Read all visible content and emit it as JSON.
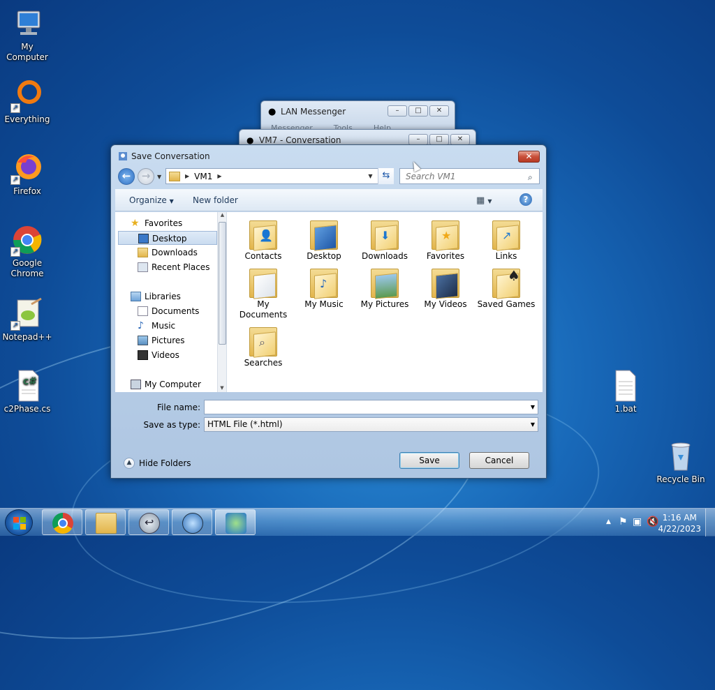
{
  "desktop": {
    "icons": [
      {
        "label": "My Computer",
        "icon": "computer-icon"
      },
      {
        "label": "Everything",
        "icon": "everything-icon"
      },
      {
        "label": "Firefox",
        "icon": "firefox-icon"
      },
      {
        "label": "Google Chrome",
        "icon": "chrome-icon"
      },
      {
        "label": "Notepad++",
        "icon": "notepadpp-icon"
      },
      {
        "label": "c2Phase.cs",
        "icon": "csharp-file-icon"
      },
      {
        "label": "1.bat",
        "icon": "bat-file-icon"
      },
      {
        "label": "Recycle Bin",
        "icon": "recycle-bin-icon"
      }
    ]
  },
  "bg_windows": {
    "lan_messenger": {
      "title": "LAN Messenger",
      "menu": [
        "Messenger",
        "Tools",
        "Help"
      ]
    },
    "conversation": {
      "title": "VM7 - Conversation"
    }
  },
  "dialog": {
    "title": "Save Conversation",
    "close_label": "✕",
    "address": {
      "crumb": "VM1"
    },
    "search_placeholder": "Search VM1",
    "toolbar": {
      "organize": "Organize",
      "new_folder": "New folder",
      "help": "?"
    },
    "nav": {
      "favorites": "Favorites",
      "desktop": "Desktop",
      "downloads": "Downloads",
      "recent_places": "Recent Places",
      "libraries": "Libraries",
      "documents": "Documents",
      "music": "Music",
      "pictures": "Pictures",
      "videos": "Videos",
      "my_computer": "My Computer"
    },
    "files": [
      {
        "label": "Contacts",
        "glyph": "contacts-icon"
      },
      {
        "label": "Desktop",
        "glyph": "desktop-icon"
      },
      {
        "label": "Downloads",
        "glyph": "download-icon"
      },
      {
        "label": "Favorites",
        "glyph": "star-icon"
      },
      {
        "label": "Links",
        "glyph": "link-icon"
      },
      {
        "label": "My Documents",
        "glyph": "document-icon"
      },
      {
        "label": "My Music",
        "glyph": "music-icon"
      },
      {
        "label": "My Pictures",
        "glyph": "picture-icon"
      },
      {
        "label": "My Videos",
        "glyph": "video-icon"
      },
      {
        "label": "Saved Games",
        "glyph": "games-icon"
      },
      {
        "label": "Searches",
        "glyph": "magnifier-icon"
      }
    ],
    "file_name_label": "File name:",
    "file_name_value": "",
    "save_type_label": "Save as type:",
    "save_type_value": "HTML File (*.html)",
    "save_button": "Save",
    "cancel_button": "Cancel",
    "hide_folders": "Hide Folders"
  },
  "taskbar": {
    "clock_time": "1:16 AM",
    "clock_date": "4/22/2023"
  }
}
